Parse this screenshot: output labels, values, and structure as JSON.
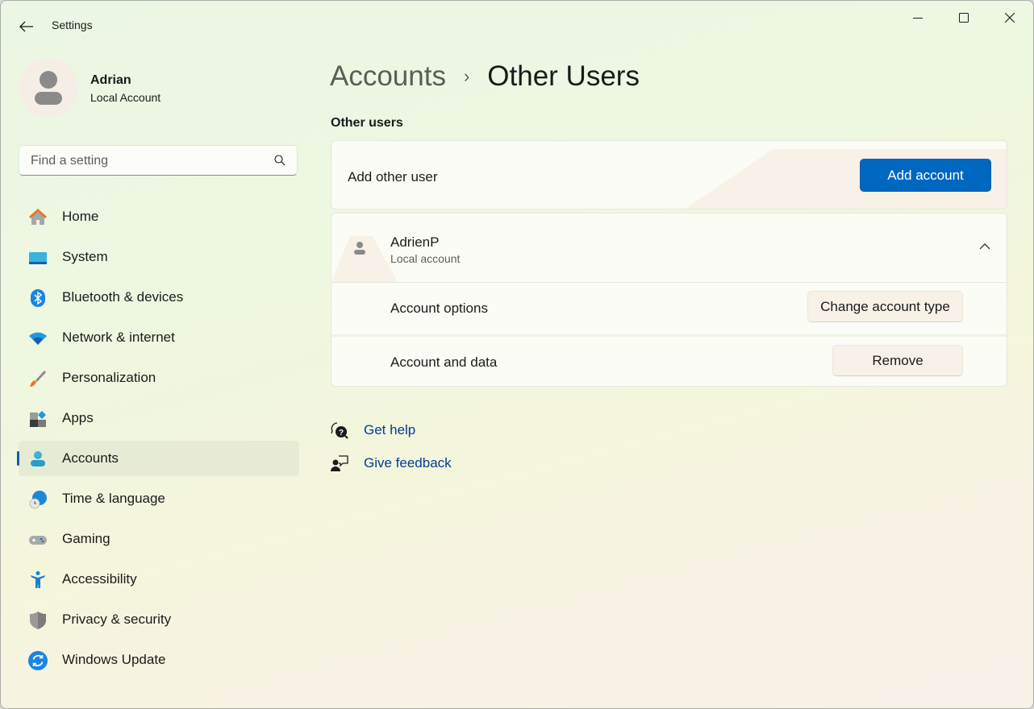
{
  "window": {
    "title": "Settings",
    "controls": {
      "minimize": "minimize",
      "maximize": "maximize",
      "close": "close"
    }
  },
  "profile": {
    "name": "Adrian",
    "account_type": "Local Account"
  },
  "search": {
    "placeholder": "Find a setting",
    "value": ""
  },
  "sidebar": {
    "items": [
      {
        "label": "Home",
        "icon": "home-icon",
        "selected": false
      },
      {
        "label": "System",
        "icon": "system-icon",
        "selected": false
      },
      {
        "label": "Bluetooth & devices",
        "icon": "bluetooth-icon",
        "selected": false
      },
      {
        "label": "Network & internet",
        "icon": "wifi-icon",
        "selected": false
      },
      {
        "label": "Personalization",
        "icon": "paintbrush-icon",
        "selected": false
      },
      {
        "label": "Apps",
        "icon": "apps-icon",
        "selected": false
      },
      {
        "label": "Accounts",
        "icon": "accounts-icon",
        "selected": true
      },
      {
        "label": "Time & language",
        "icon": "time-language-icon",
        "selected": false
      },
      {
        "label": "Gaming",
        "icon": "gamepad-icon",
        "selected": false
      },
      {
        "label": "Accessibility",
        "icon": "accessibility-icon",
        "selected": false
      },
      {
        "label": "Privacy & security",
        "icon": "shield-icon",
        "selected": false
      },
      {
        "label": "Windows Update",
        "icon": "update-icon",
        "selected": false
      }
    ]
  },
  "main": {
    "breadcrumb": {
      "parent": "Accounts",
      "separator": "›",
      "current": "Other Users"
    },
    "section_title": "Other users",
    "add_card": {
      "label": "Add other user",
      "button": "Add account"
    },
    "user_card": {
      "name": "AdrienP",
      "type": "Local account",
      "expanded": true,
      "options": [
        {
          "label": "Account options",
          "button": "Change account type"
        },
        {
          "label": "Account and data",
          "button": "Remove"
        }
      ]
    },
    "links": {
      "help": "Get help",
      "feedback": "Give feedback"
    }
  },
  "colors": {
    "accent": "#0067c0",
    "link": "#003e92",
    "selected_indicator": "#005fb8"
  }
}
